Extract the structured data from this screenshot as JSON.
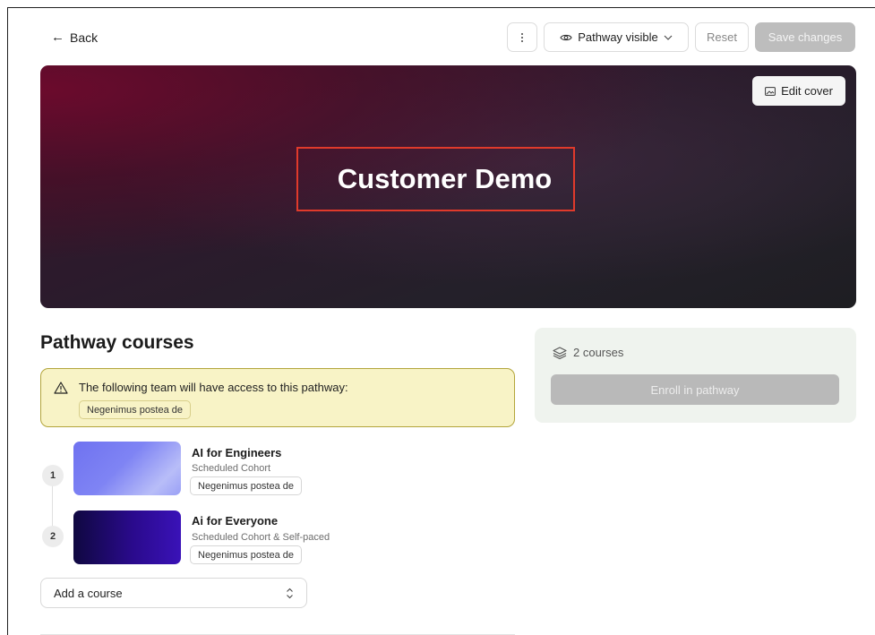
{
  "topbar": {
    "back_label": "Back",
    "visibility_label": "Pathway visible",
    "reset_label": "Reset",
    "save_label": "Save changes"
  },
  "cover": {
    "title": "Customer Demo",
    "edit_cover_label": "Edit cover"
  },
  "pathway": {
    "section_title": "Pathway courses",
    "notice_text": "The following team will have access to this pathway:",
    "team_chip": "Negenimus postea de",
    "courses": [
      {
        "step": "1",
        "title": "AI for Engineers",
        "type": "Scheduled Cohort",
        "team": "Negenimus postea de"
      },
      {
        "step": "2",
        "title": "Ai for Everyone",
        "type": "Scheduled Cohort & Self-paced",
        "team": "Negenimus postea de"
      }
    ],
    "add_course_placeholder": "Add a course"
  },
  "enroll": {
    "course_count": "2 courses",
    "enroll_label": "Enroll in pathway"
  },
  "colors": {
    "highlight_border": "#e03a2b",
    "notice_bg": "#f8f3c6",
    "card_bg": "#eff3ee",
    "disabled_button": "#b9b9b9"
  },
  "icons": [
    "arrow-left-icon",
    "more-vertical-icon",
    "eye-icon",
    "chevron-down-icon",
    "image-icon",
    "warning-icon",
    "layers-icon",
    "chevron-updown-icon"
  ]
}
